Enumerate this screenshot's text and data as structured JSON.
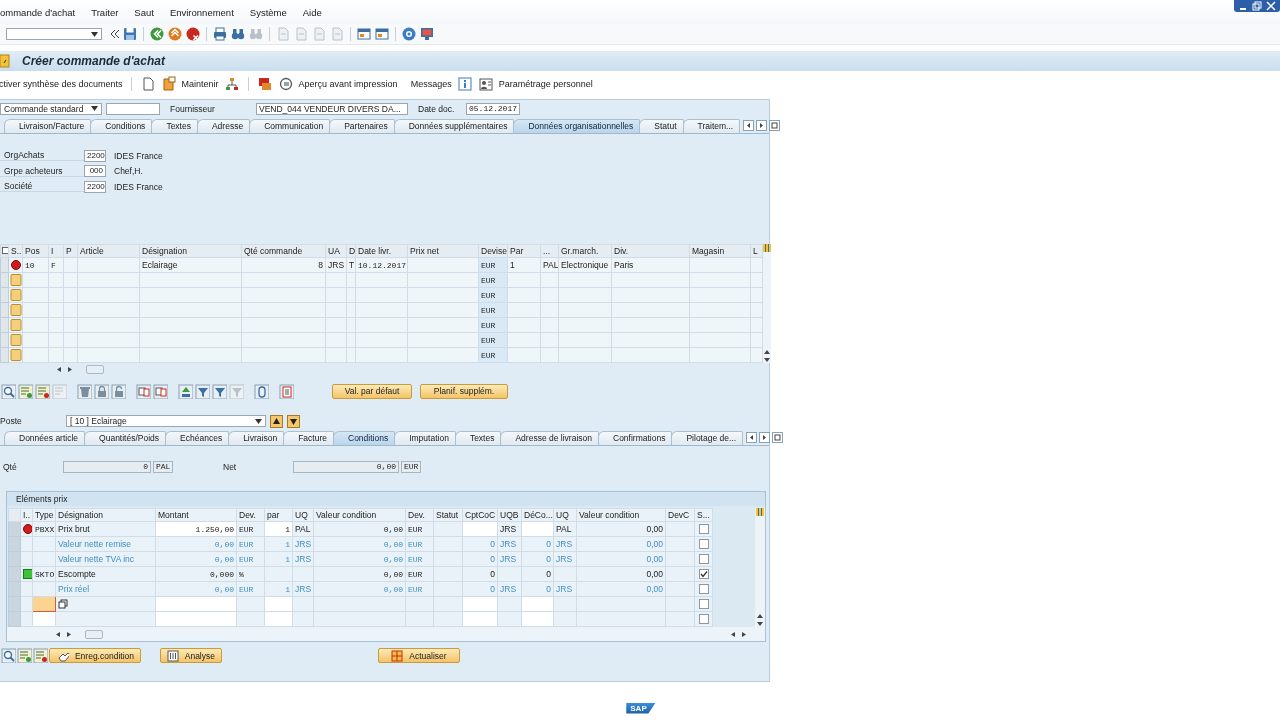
{
  "menu": [
    "ommande d'achat",
    "Traiter",
    "Saut",
    "Environnement",
    "Système",
    "Aide"
  ],
  "title": "Créer commande d'achat",
  "app_toolbar": [
    "ctiver synthèse des documents",
    "Maintenir",
    "Aperçu avant impression",
    "Messages",
    "Paramétrage personnel"
  ],
  "header": {
    "doc_type": "Commande standard",
    "supplier_label": "Fournisseur",
    "supplier": "VEND_044 VENDEUR DIVERS DA...",
    "date_label": "Date doc.",
    "date": "05.12.2017"
  },
  "header_tabs": [
    {
      "label": "Livraison/Facture",
      "selected": false
    },
    {
      "label": "Conditions",
      "selected": false
    },
    {
      "label": "Textes",
      "selected": false
    },
    {
      "label": "Adresse",
      "selected": false
    },
    {
      "label": "Communication",
      "selected": false
    },
    {
      "label": "Partenaires",
      "selected": false
    },
    {
      "label": "Données supplémentaires",
      "selected": false
    },
    {
      "label": "Données organisationnelles",
      "selected": true
    },
    {
      "label": "Statut",
      "selected": false
    },
    {
      "label": "Traitem...",
      "selected": false
    }
  ],
  "org_fields": [
    {
      "label": "OrgAchats",
      "code": "2200",
      "text": "IDES France"
    },
    {
      "label": "Grpe acheteurs",
      "code": "000",
      "text": "Chef,H."
    },
    {
      "label": "Société",
      "code": "2200",
      "text": "IDES France"
    }
  ],
  "items": {
    "columns": [
      "S..",
      "Pos",
      "I",
      "P",
      "Article",
      "Désignation",
      "Qté commande",
      "UA",
      "D",
      "Date livr.",
      "Prix net",
      "Devise",
      "Par",
      "...",
      "Gr.march.",
      "Div.",
      "Magasin",
      "L"
    ],
    "rows": [
      {
        "kind": "error",
        "cells": [
          "",
          "10",
          "F",
          "",
          "",
          "Eclairage",
          "8",
          "JRS",
          "T",
          "10.12.2017",
          "",
          "EUR",
          "1",
          "PAL",
          "Electronique",
          "Paris",
          "",
          ""
        ]
      },
      {
        "kind": "new",
        "cells": [
          "",
          "",
          "",
          "",
          "",
          "",
          "",
          "",
          "",
          "",
          "",
          "EUR",
          "",
          "",
          "",
          "",
          "",
          ""
        ]
      },
      {
        "kind": "new",
        "cells": [
          "",
          "",
          "",
          "",
          "",
          "",
          "",
          "",
          "",
          "",
          "",
          "EUR",
          "",
          "",
          "",
          "",
          "",
          ""
        ]
      },
      {
        "kind": "new",
        "cells": [
          "",
          "",
          "",
          "",
          "",
          "",
          "",
          "",
          "",
          "",
          "",
          "EUR",
          "",
          "",
          "",
          "",
          "",
          ""
        ]
      },
      {
        "kind": "new",
        "cells": [
          "",
          "",
          "",
          "",
          "",
          "",
          "",
          "",
          "",
          "",
          "",
          "EUR",
          "",
          "",
          "",
          "",
          "",
          ""
        ]
      },
      {
        "kind": "new",
        "cells": [
          "",
          "",
          "",
          "",
          "",
          "",
          "",
          "",
          "",
          "",
          "",
          "EUR",
          "",
          "",
          "",
          "",
          "",
          ""
        ]
      },
      {
        "kind": "new",
        "cells": [
          "",
          "",
          "",
          "",
          "",
          "",
          "",
          "",
          "",
          "",
          "",
          "EUR",
          "",
          "",
          "",
          "",
          "",
          ""
        ]
      }
    ]
  },
  "item_buttons": [
    "Val. par défaut",
    "Planif. supplém."
  ],
  "poste": {
    "label": "Poste",
    "value": "[ 10 ] Eclairage"
  },
  "item_tabs": [
    {
      "label": "Données article",
      "selected": false
    },
    {
      "label": "Quantités/Poids",
      "selected": false
    },
    {
      "label": "Echéances",
      "selected": false
    },
    {
      "label": "Livraison",
      "selected": false
    },
    {
      "label": "Facture",
      "selected": false
    },
    {
      "label": "Conditions",
      "selected": true
    },
    {
      "label": "Imputation",
      "selected": false
    },
    {
      "label": "Textes",
      "selected": false
    },
    {
      "label": "Adresse de livraison",
      "selected": false
    },
    {
      "label": "Confirmations",
      "selected": false
    },
    {
      "label": "Pilotage de...",
      "selected": false
    }
  ],
  "quantity": {
    "label": "Qté",
    "value": "0",
    "unit": "PAL"
  },
  "net": {
    "label": "Net",
    "value": "0,00",
    "unit": "EUR"
  },
  "pricing": {
    "title": "Eléments prix",
    "columns": [
      "I..",
      "Type",
      "Désignation",
      "Montant",
      "Dev.",
      "par",
      "UQ",
      "Valeur condition",
      "Dev.",
      "Statut",
      "CptCoC",
      "UQB",
      "DéCo...",
      "UQ",
      "Valeur condition",
      "DevC",
      "S..."
    ],
    "rows": [
      {
        "kind": "condition",
        "light": {
          "kind": "error"
        },
        "editable": true,
        "cursor": false,
        "checked": false,
        "cells": [
          "",
          "PBXX",
          "Prix brut",
          "1.250,00",
          "EUR",
          "1",
          "PAL",
          "0,00",
          "EUR",
          "",
          "",
          "JRS",
          "",
          "PAL",
          "0,00",
          ""
        ]
      },
      {
        "kind": "subtotal",
        "editable": false,
        "cursor": false,
        "checked": false,
        "cells": [
          "",
          "",
          "Valeur nette remise",
          "0,00",
          "EUR",
          "1",
          "JRS",
          "0,00",
          "EUR",
          "",
          "0",
          "JRS",
          "0",
          "JRS",
          "0,00",
          ""
        ]
      },
      {
        "kind": "subtotal",
        "editable": false,
        "cursor": false,
        "checked": false,
        "cells": [
          "",
          "",
          "Valeur nette TVA inc",
          "0,00",
          "EUR",
          "1",
          "JRS",
          "0,00",
          "EUR",
          "",
          "0",
          "JRS",
          "0",
          "JRS",
          "0,00",
          ""
        ]
      },
      {
        "kind": "condition",
        "light": {
          "kind": "ok"
        },
        "editable": false,
        "cursor": false,
        "checked": true,
        "cells": [
          "",
          "SKTO",
          "Escompte",
          "0,000",
          "%",
          "",
          "",
          "0,00",
          "EUR",
          "",
          "0",
          "",
          "0",
          "",
          "0,00",
          ""
        ]
      },
      {
        "kind": "subtotal",
        "editable": false,
        "cursor": false,
        "checked": false,
        "cells": [
          "",
          "",
          "Prix réel",
          "0,00",
          "EUR",
          "1",
          "JRS",
          "0,00",
          "EUR",
          "",
          "0",
          "JRS",
          "0",
          "JRS",
          "0,00",
          ""
        ]
      },
      {
        "kind": "empty",
        "editable": true,
        "cursor": true,
        "checked": false,
        "cells": [
          "",
          "",
          "",
          "",
          "",
          "",
          "",
          "",
          "",
          "",
          "",
          "",
          "",
          "",
          "",
          ""
        ]
      },
      {
        "kind": "empty",
        "editable": true,
        "cursor": false,
        "checked": false,
        "cells": [
          "",
          "",
          "",
          "",
          "",
          "",
          "",
          "",
          "",
          "",
          "",
          "",
          "",
          "",
          "",
          ""
        ]
      }
    ]
  },
  "pricing_buttons": [
    "Enreg.condition",
    "Analyse",
    "Actualiser"
  ],
  "footer_logo": "SAP"
}
